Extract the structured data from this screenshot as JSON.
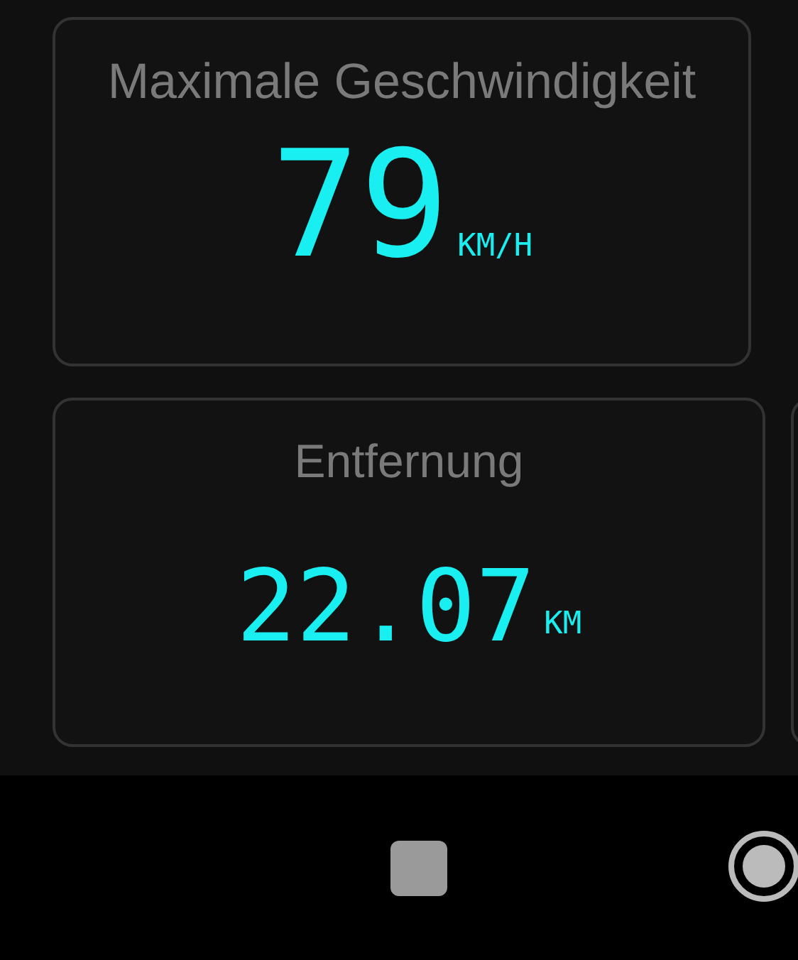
{
  "cards": [
    {
      "title": "Maximale Geschwindigkeit",
      "value": "79",
      "unit": "KM/H"
    },
    {
      "title": "Entfernung",
      "value": "22.07",
      "unit": "KM"
    }
  ]
}
